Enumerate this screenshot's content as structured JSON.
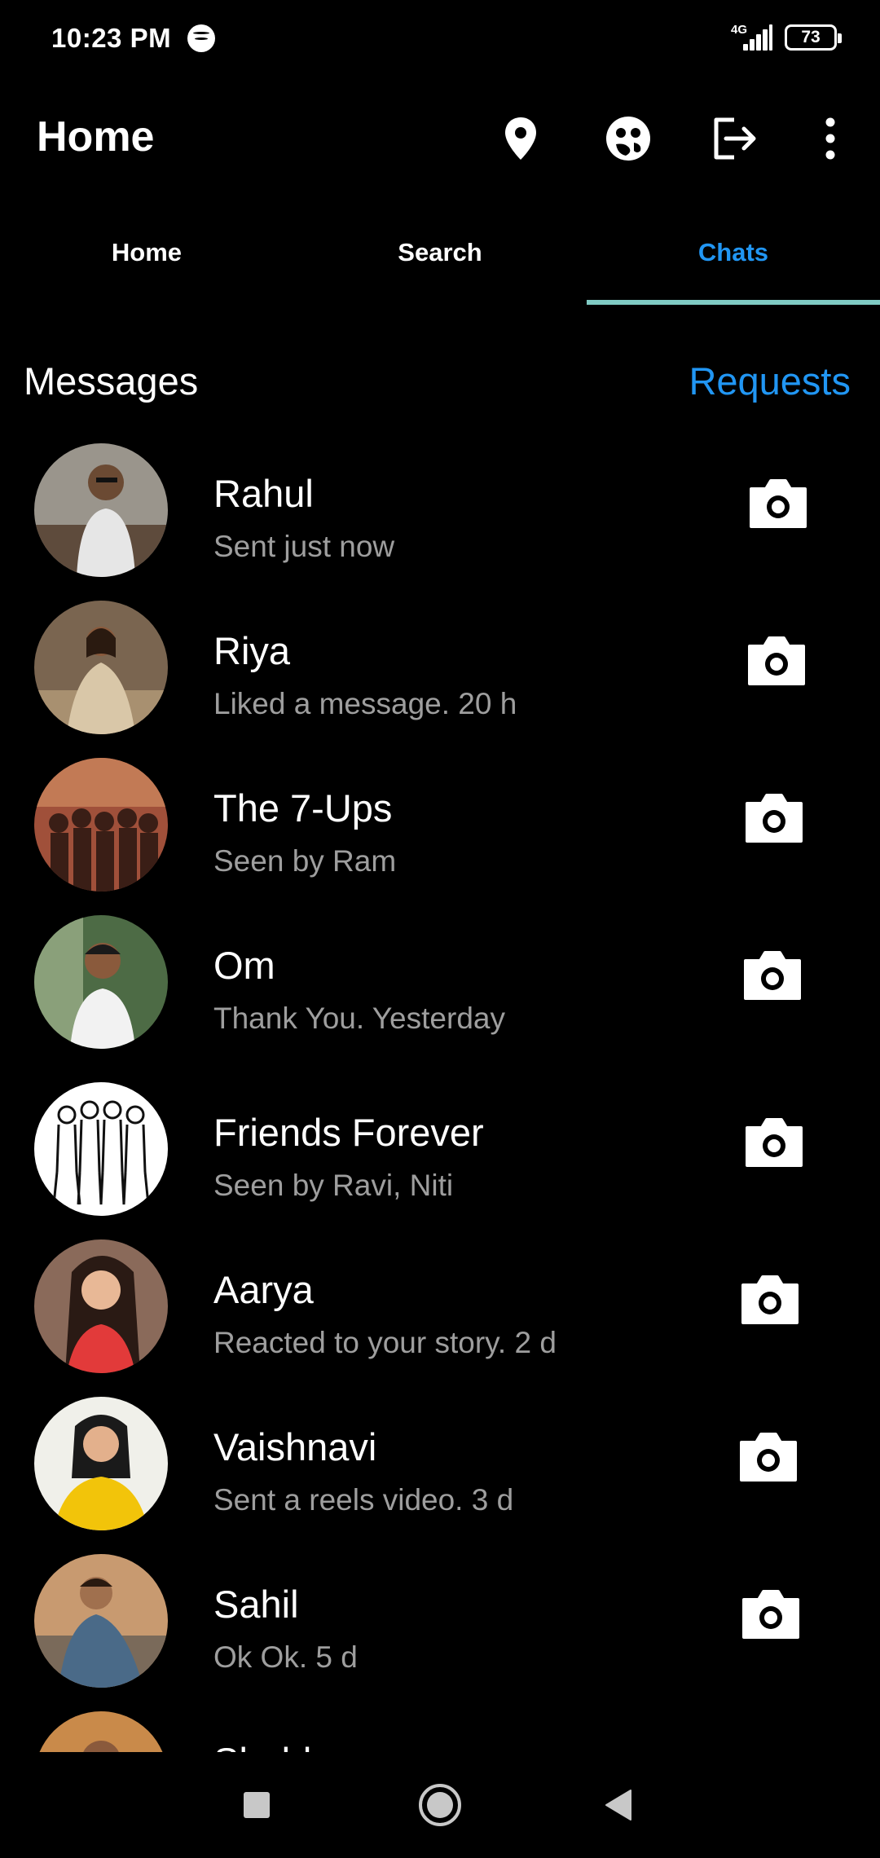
{
  "status_bar": {
    "time": "10:23 PM",
    "network": "4G",
    "battery": "73"
  },
  "app_bar": {
    "title": "Home",
    "icons": [
      "location-pin-icon",
      "bitmoji-icon",
      "logout-icon",
      "more-vertical-icon"
    ]
  },
  "tabs": [
    {
      "label": "Home",
      "active": false
    },
    {
      "label": "Search",
      "active": false
    },
    {
      "label": "Chats",
      "active": true
    }
  ],
  "section": {
    "title": "Messages",
    "requests_label": "Requests"
  },
  "chats": [
    {
      "name": "Rahul",
      "status": "Sent just now",
      "avatar_bg": "#8d8d8d"
    },
    {
      "name": "Riya",
      "status": "Liked a message. 20 h",
      "avatar_bg": "#6b5440"
    },
    {
      "name": "The 7-Ups",
      "status": "Seen by Ram",
      "avatar_bg": "#7a3b2e"
    },
    {
      "name": "Om",
      "status": "Thank You. Yesterday",
      "avatar_bg": "#3f5b3a"
    },
    {
      "name": "Friends Forever",
      "status": "Seen by Ravi, Niti",
      "avatar_bg": "#ffffff"
    },
    {
      "name": "Aarya",
      "status": "Reacted to your story. 2 d",
      "avatar_bg": "#6d4a3f"
    },
    {
      "name": "Vaishnavi",
      "status": "Sent a reels video. 3 d",
      "avatar_bg": "#e8c02c"
    },
    {
      "name": "Sahil",
      "status": "Ok Ok. 5 d",
      "avatar_bg": "#4f6b7a"
    },
    {
      "name": "Shubh",
      "status": "",
      "avatar_bg": "#c98a4a"
    }
  ],
  "colors": {
    "accent": "#2196f3",
    "tab_indicator": "#80cbc4",
    "secondary_text": "#9e9e9e",
    "background": "#000000"
  },
  "nav": [
    "recents-square-icon",
    "home-circle-icon",
    "back-triangle-icon"
  ]
}
